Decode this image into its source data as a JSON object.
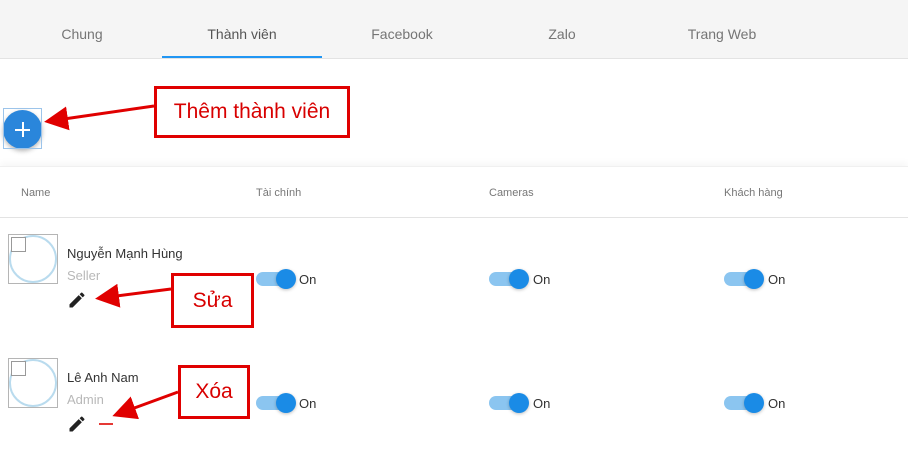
{
  "tabs": [
    "Chung",
    "Thành viên",
    "Facebook",
    "Zalo",
    "Trang Web"
  ],
  "active_tab": "Thành viên",
  "add_member_button": {
    "icon": "plus-icon"
  },
  "table": {
    "headers": [
      "Name",
      "Tài chính",
      "Cameras",
      "Khách hàng"
    ],
    "rows": [
      {
        "name": "Nguyễn Mạnh Hùng",
        "role": "Seller",
        "actions": [
          "edit-icon"
        ],
        "permissions": [
          {
            "state": "On"
          },
          {
            "state": "On"
          },
          {
            "state": "On"
          }
        ]
      },
      {
        "name": "Lê Anh Nam",
        "role": "Admin",
        "actions": [
          "edit-icon",
          "remove-icon"
        ],
        "permissions": [
          {
            "state": "On"
          },
          {
            "state": "On"
          },
          {
            "state": "On"
          }
        ]
      }
    ]
  },
  "annotations": {
    "add_member": "Thêm thành viên",
    "edit": "Sửa",
    "delete": "Xóa"
  },
  "colors": {
    "accent": "#2196f3",
    "fab": "#2a86db",
    "toggle_on": "#1a8be6",
    "toggle_track": "#8bc5f0",
    "annotation_red": "#e00000",
    "delete_red": "#e53935"
  }
}
